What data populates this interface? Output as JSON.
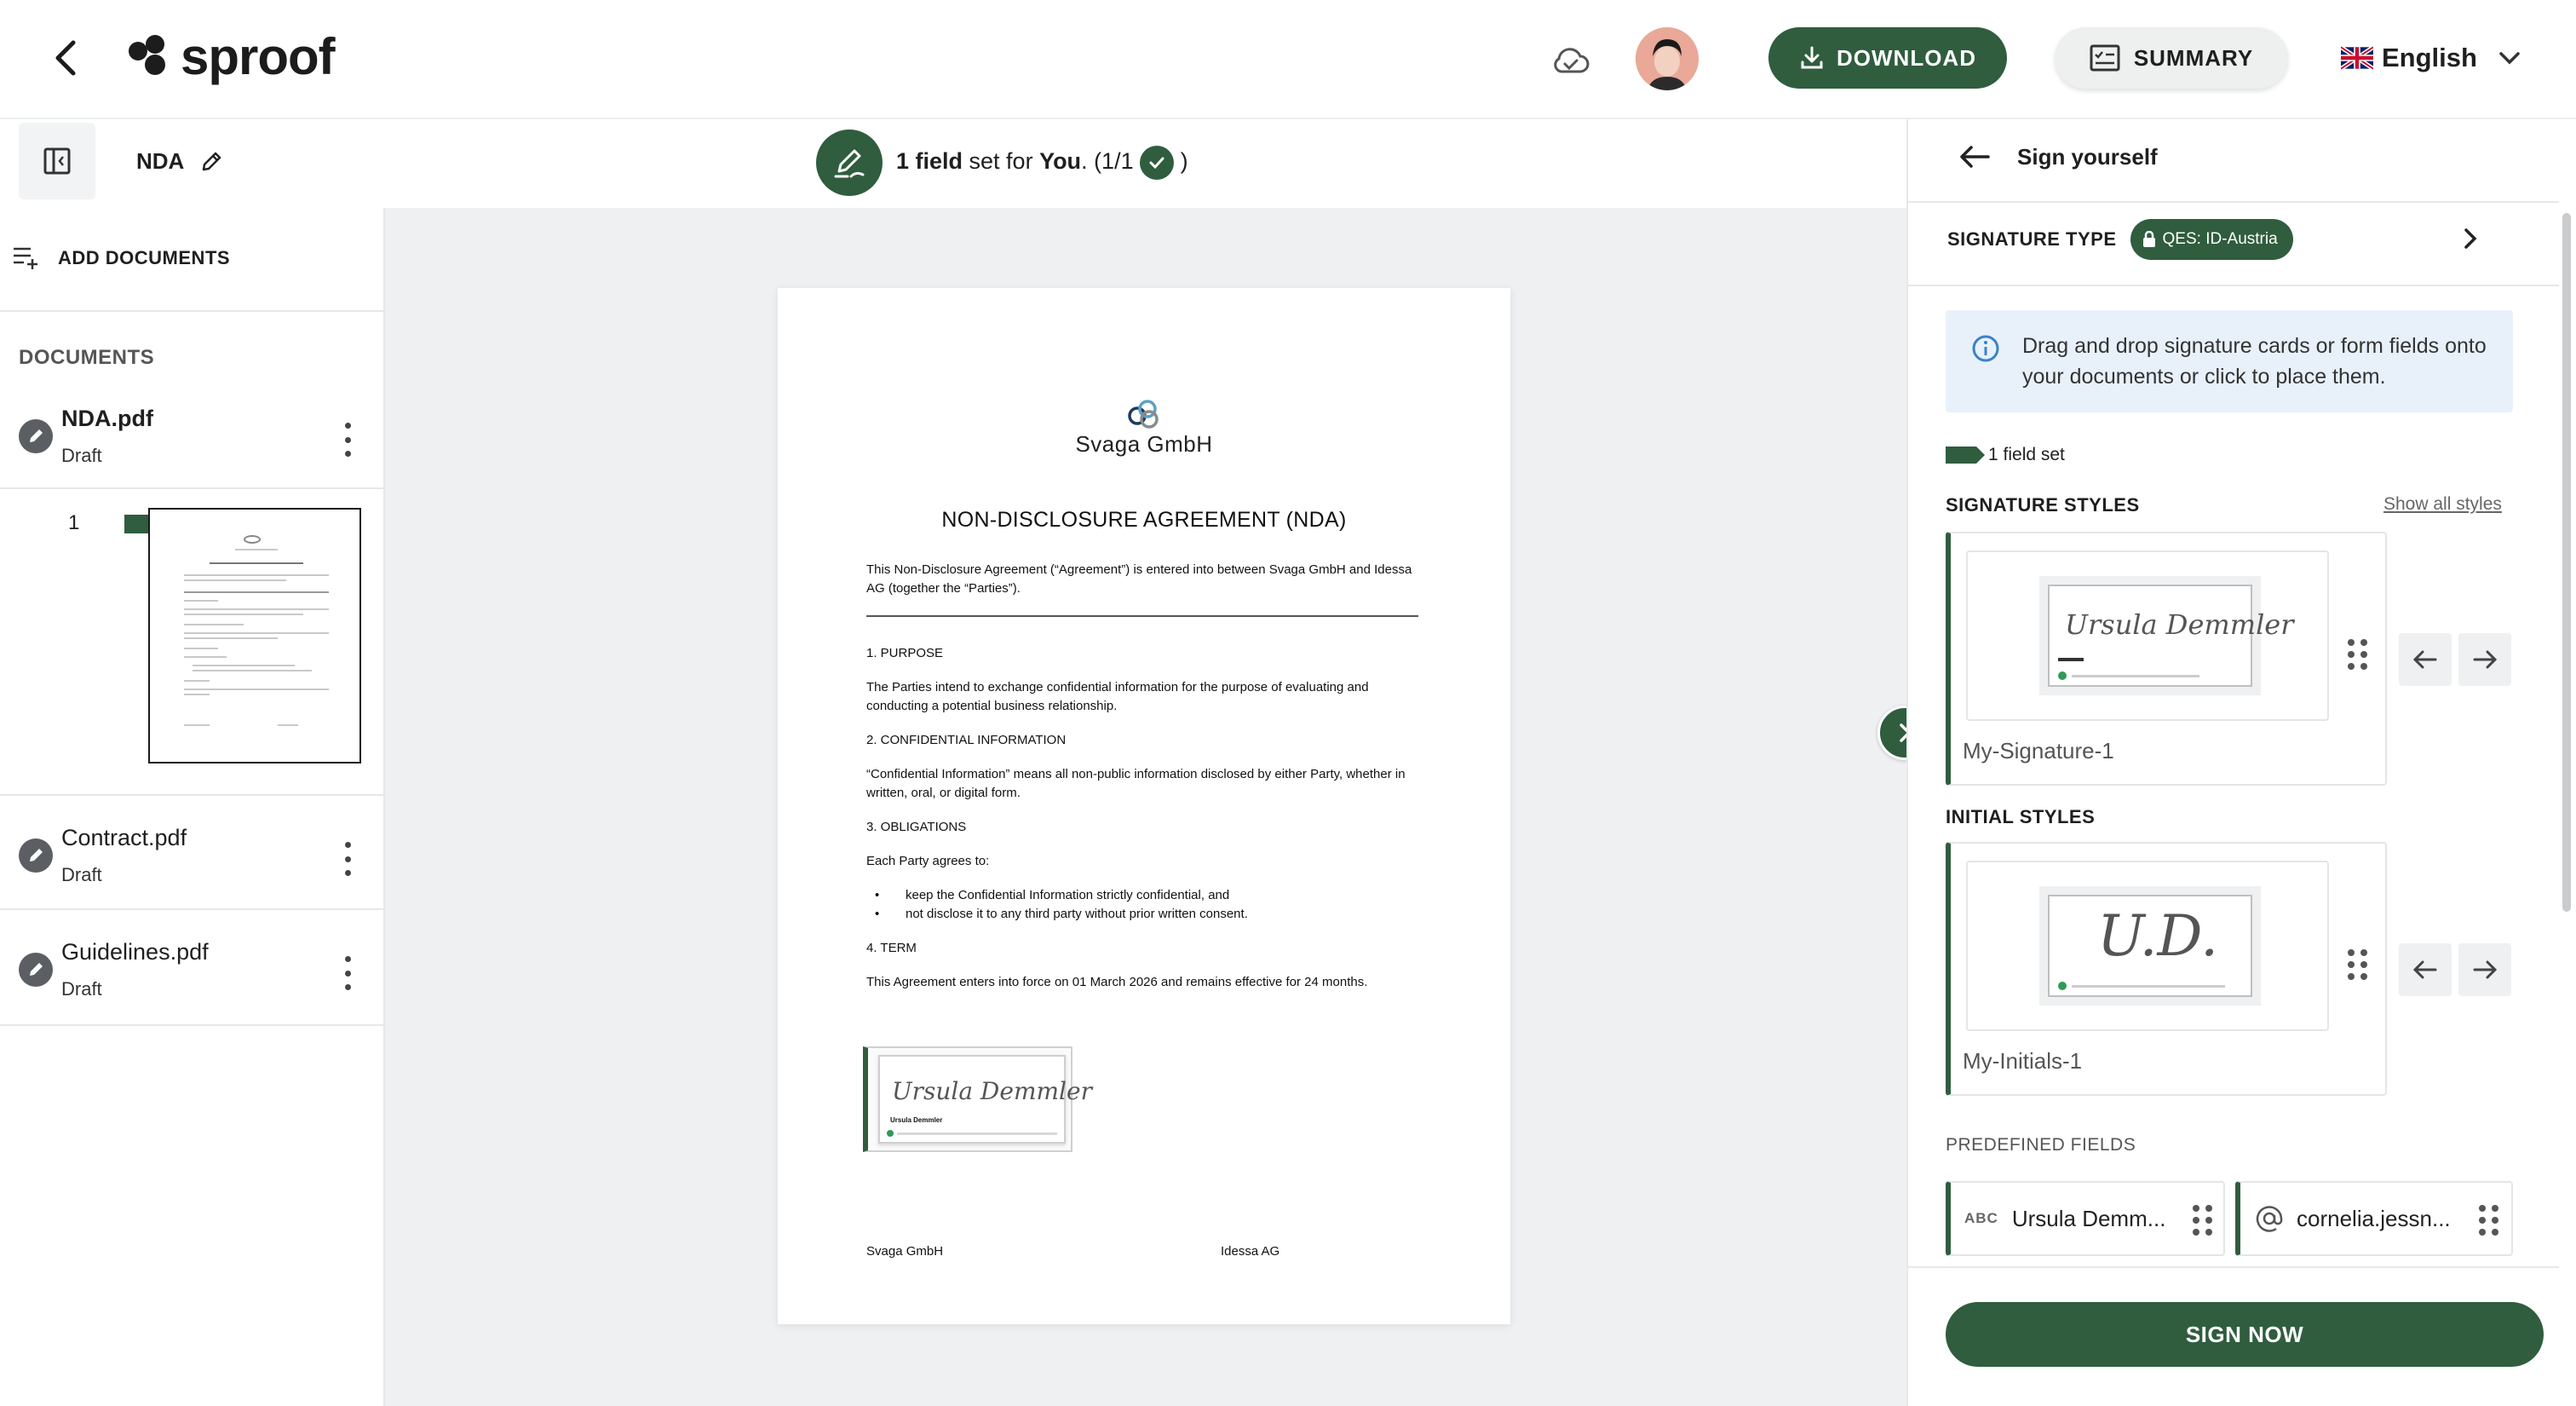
{
  "header": {
    "logo_text": "sproof",
    "download_label": "DOWNLOAD",
    "summary_label": "SUMMARY",
    "language": "English"
  },
  "subbar": {
    "document_name": "NDA",
    "status": {
      "count_label": "1 field",
      "text_mid": " set for ",
      "recipient": "You",
      "progress": ". (1/1",
      "close": ")"
    }
  },
  "sidebar": {
    "add_documents_label": "ADD DOCUMENTS",
    "documents_title": "DOCUMENTS",
    "documents": [
      {
        "name": "NDA.pdf",
        "status": "Draft"
      },
      {
        "name": "Contract.pdf",
        "status": "Draft"
      },
      {
        "name": "Guidelines.pdf",
        "status": "Draft"
      }
    ],
    "page_number": "1"
  },
  "document": {
    "company": "Svaga GmbH",
    "title": "NON-DISCLOSURE AGREEMENT (NDA)",
    "intro": "This Non-Disclosure Agreement (“Agreement”) is entered into between Svaga GmbH and Idessa AG (together the “Parties”).",
    "purpose_heading": "1. PURPOSE",
    "purpose_text": "The Parties intend to exchange confidential information for the purpose of evaluating and conducting a potential business relationship.",
    "confidential_heading": "2. CONFIDENTIAL INFORMATION",
    "confidential_text": "“Confidential Information” means all non-public information disclosed by either Party, whether in written, oral, or digital form.",
    "obligations_heading": "3. OBLIGATIONS",
    "obligations_intro": "Each Party agrees to:",
    "obligations": [
      "keep the Confidential Information strictly confidential, and",
      "not disclose it to any third party without prior written consent."
    ],
    "term_heading": "4. TERM",
    "term_text": "This Agreement enters into force on 01 March 2026 and remains effective for 24 months.",
    "signature_script": "Ursula Demmler",
    "signature_name": "Ursula Demmler",
    "party_left": "Svaga GmbH",
    "party_right": "Idessa AG"
  },
  "right_panel": {
    "title": "Sign yourself",
    "signature_type_label": "SIGNATURE TYPE",
    "signature_type_value": "QES: ID-Austria",
    "info_text": "Drag and drop signature cards or form fields onto your documents or click to place them.",
    "fields_set": "1 field set",
    "signature_styles_title": "SIGNATURE STYLES",
    "show_all_styles": "Show all styles",
    "signature_style_name": "My-Signature-1",
    "signature_style_script": "Ursula Demmler",
    "initial_styles_title": "INITIAL STYLES",
    "initial_style_name": "My-Initials-1",
    "initial_style_script": "U.D.",
    "predefined_title": "PREDEFINED FIELDS",
    "predefined_fields": [
      "Ursula Demm...",
      "cornelia.jessn..."
    ],
    "sign_now_label": "SIGN NOW"
  },
  "colors": {
    "brand_green": "#2f5d3e",
    "info_bg": "#e8f1fa"
  }
}
